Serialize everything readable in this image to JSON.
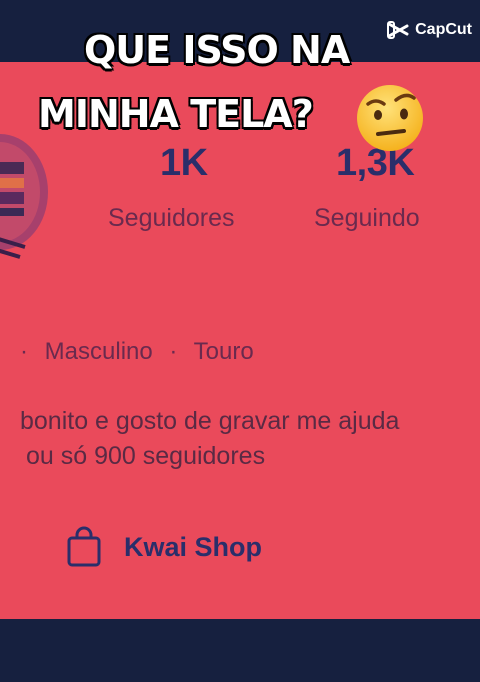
{
  "profile": {
    "followers_value": "1K",
    "followers_label": "Seguidores",
    "following_value": "1,3K",
    "following_label": "Seguindo",
    "meta": [
      "·",
      "Masculino",
      "·",
      "Touro"
    ],
    "bio_line1": "bonito e gosto de gravar me ajuda",
    "bio_line2": "ou só 900 seguidores",
    "shop_label": "Kwai Shop"
  },
  "overlay": {
    "caption_line1": "QUE ISSO NA",
    "caption_line2": "MINHA TELA?",
    "emoji": "raised-eyebrow-face",
    "watermark": "CapCut"
  },
  "colors": {
    "screen_bg": "#ea4a5b",
    "frame_bg": "#16203f",
    "stat_text": "#2a2e6a"
  }
}
